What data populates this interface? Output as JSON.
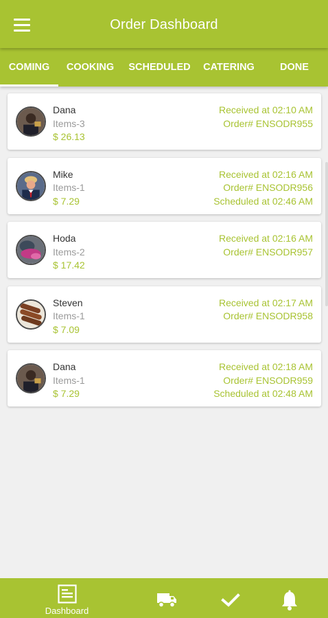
{
  "header": {
    "title": "Order Dashboard",
    "menu_icon": "menu-icon"
  },
  "tabs": [
    {
      "label": "COMING",
      "active": true
    },
    {
      "label": "COOKING",
      "active": false
    },
    {
      "label": "SCHEDULED",
      "active": false
    },
    {
      "label": "CATERING",
      "active": false
    },
    {
      "label": "DONE",
      "active": false
    }
  ],
  "orders": [
    {
      "name": "Dana",
      "items": "Items-3",
      "price": "$ 26.13",
      "received": "Received at 02:10 AM",
      "order_no": "Order# ENSODR955",
      "scheduled": ""
    },
    {
      "name": "Mike",
      "items": "Items-1",
      "price": "$ 7.29",
      "received": "Received at 02:16 AM",
      "order_no": "Order# ENSODR956",
      "scheduled": "Scheduled at 02:46 AM"
    },
    {
      "name": "Hoda",
      "items": "Items-2",
      "price": "$ 17.42",
      "received": "Received at 02:16 AM",
      "order_no": "Order# ENSODR957",
      "scheduled": ""
    },
    {
      "name": "Steven",
      "items": "Items-1",
      "price": "$ 7.09",
      "received": "Received at 02:17 AM",
      "order_no": "Order# ENSODR958",
      "scheduled": ""
    },
    {
      "name": "Dana",
      "items": "Items-1",
      "price": "$ 7.29",
      "received": "Received at 02:18 AM",
      "order_no": "Order# ENSODR959",
      "scheduled": "Scheduled at 02:48 AM"
    }
  ],
  "bottom_nav": [
    {
      "label": "Dashboard",
      "icon": "dashboard-icon"
    },
    {
      "label": "",
      "icon": "delivery-truck-icon"
    },
    {
      "label": "",
      "icon": "checkmark-icon"
    },
    {
      "label": "",
      "icon": "bell-icon"
    }
  ],
  "colors": {
    "accent": "#a8c332",
    "background": "#f0f0f0",
    "card": "#ffffff",
    "name_text": "#333333",
    "muted_text": "#9a9a9a"
  }
}
